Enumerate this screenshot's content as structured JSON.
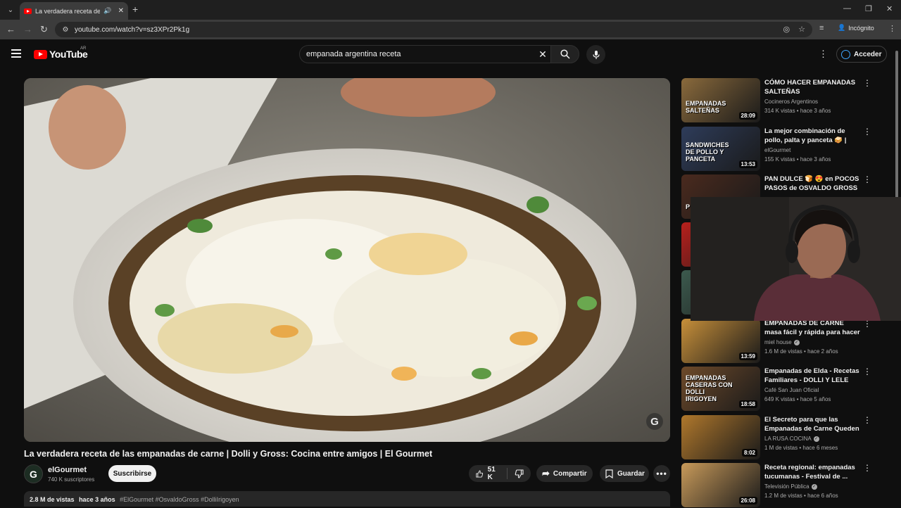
{
  "browser": {
    "tab_title": "La verdadera receta de las empanadas",
    "url": "youtube.com/watch?v=sz3XPr2Pk1g",
    "incognito_label": "Incógnito"
  },
  "header": {
    "country": "AR",
    "search_value": "empanada argentina receta",
    "sign_in_label": "Acceder"
  },
  "video": {
    "title": "La verdadera receta de las empanadas de carne | Dolli y Gross: Cocina entre amigos | El Gourmet",
    "channel_initial": "G",
    "channel_name": "elGourmet",
    "subscribers": "740 K suscriptores",
    "subscribe_label": "Suscribirse",
    "likes": "51 K",
    "share_label": "Compartir",
    "save_label": "Guardar",
    "views": "2.8 M de vistas",
    "age": "hace 3 años",
    "hashtags": "#ElGourmet #OsvaldoGross #DolliIrigoyen",
    "watermark": "G"
  },
  "recommendations": [
    {
      "title": "CÓMO HACER EMPANADAS SALTEÑAS",
      "channel": "Cocineros Argentinos",
      "verified": false,
      "views": "314 K vistas",
      "age": "hace 3 años",
      "duration": "28:09",
      "thumb_text": "EMPANADAS SALTEÑAS",
      "thumb_color": "#8a6a3c"
    },
    {
      "title": "La mejor combinación de pollo, palta y panceta 🥪 | Maestros ...",
      "channel": "elGourmet",
      "verified": false,
      "views": "155 K vistas",
      "age": "hace 3 años",
      "duration": "13:53",
      "thumb_text": "SANDWICHES DE POLLO Y PANCETA",
      "thumb_color": "#2e3c5a"
    },
    {
      "title": "PAN DULCE 🍞 😍 en POCOS PASOS de OSVALDO GROSS | ...",
      "channel": "",
      "verified": false,
      "views": "",
      "age": "",
      "duration": "",
      "thumb_text": "P",
      "thumb_color": "#4a2a1e"
    },
    {
      "title": "",
      "channel": "",
      "verified": false,
      "views": "",
      "age": "",
      "duration": "",
      "thumb_text": "",
      "thumb_color": "#b8201c"
    },
    {
      "title": "",
      "channel": "",
      "verified": false,
      "views": "",
      "age": "",
      "duration": "",
      "thumb_text": "",
      "thumb_color": "#3c5a4e"
    },
    {
      "title": "EMPANADAS DE CARNE masa fácil y rápida para hacer las ...",
      "channel": "miel house",
      "verified": true,
      "views": "1.6 M de vistas",
      "age": "hace 2 años",
      "duration": "13:59",
      "thumb_text": "",
      "thumb_color": "#c8903a"
    },
    {
      "title": "Empanadas de Elda - Recetas Familiares - DOLLI Y LELE",
      "channel": "Café San Juan Oficial",
      "verified": false,
      "views": "649 K vistas",
      "age": "hace 5 años",
      "duration": "18:58",
      "thumb_text": "EMPANADAS CASERAS CON DOLLI IRIGOYEN",
      "thumb_color": "#6e4a2a"
    },
    {
      "title": "El Secreto para que las Empanadas de Carne Queden ...",
      "channel": "LA RUSA COCINA",
      "verified": true,
      "views": "1 M de vistas",
      "age": "hace 6 meses",
      "duration": "8:02",
      "thumb_text": "",
      "thumb_color": "#b0782c"
    },
    {
      "title": "Receta regional: empanadas tucumanas - Festival de ...",
      "channel": "Televisión Pública",
      "verified": true,
      "views": "1.2 M de vistas",
      "age": "hace 6 años",
      "duration": "26:08",
      "thumb_text": "",
      "thumb_color": "#c89a5a"
    }
  ]
}
